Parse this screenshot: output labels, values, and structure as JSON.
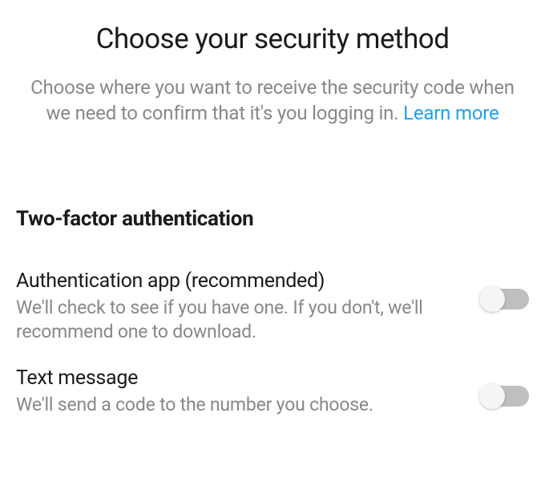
{
  "header": {
    "title": "Choose your security method",
    "subtitle": "Choose where you want to receive the security code when we need to confirm that it's you logging in.",
    "learn_more": "Learn more"
  },
  "section": {
    "title": "Two-factor authentication"
  },
  "options": [
    {
      "title": "Authentication app (recommended)",
      "desc": "We'll check to see if you have one. If you don't, we'll recommend one to download.",
      "enabled": false
    },
    {
      "title": "Text message",
      "desc": "We'll send a code to the number you choose.",
      "enabled": false
    }
  ]
}
